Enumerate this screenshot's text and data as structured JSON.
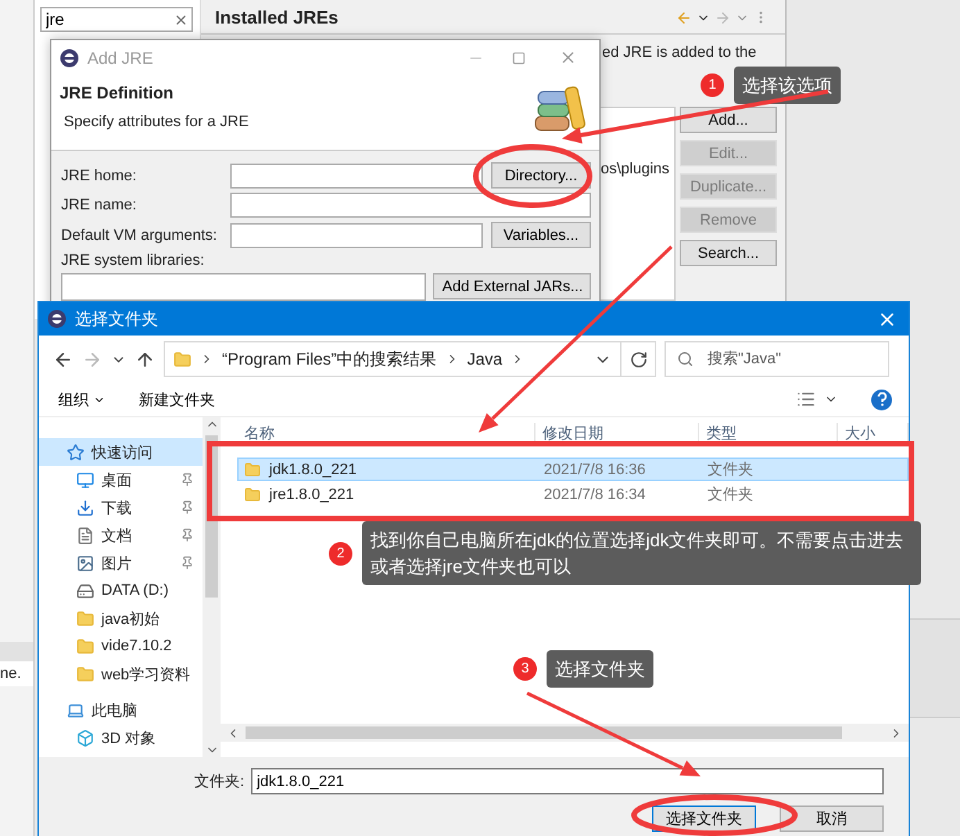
{
  "preferences": {
    "filter": {
      "value": "jre"
    },
    "title": "Installed JREs",
    "description": "ed JRE is added to the",
    "table_cell": "os\\plugins",
    "status_text": "ne.",
    "buttons": [
      {
        "label": "Add...",
        "disabled": false
      },
      {
        "label": "Edit...",
        "disabled": true
      },
      {
        "label": "Duplicate...",
        "disabled": true
      },
      {
        "label": "Remove",
        "disabled": true
      },
      {
        "label": "Search...",
        "disabled": false
      }
    ]
  },
  "add_jre_dialog": {
    "title": "Add JRE",
    "heading": "JRE Definition",
    "subtitle": "Specify attributes for a JRE",
    "fields": [
      {
        "label": "JRE home:",
        "button": "Directory..."
      },
      {
        "label": "JRE name:"
      },
      {
        "label": "Default VM arguments:",
        "button": "Variables..."
      }
    ],
    "libraries_label": "JRE system libraries:",
    "libraries_button": "Add External JARs..."
  },
  "folder_dialog": {
    "title": "选择文件夹",
    "breadcrumb": [
      "“Program Files”中的搜索结果",
      "Java"
    ],
    "search": {
      "placeholder": "搜索\"Java\""
    },
    "toolbar": [
      {
        "label": "组织",
        "dropdown": true
      },
      {
        "label": "新建文件夹",
        "dropdown": false
      }
    ],
    "sidebar": {
      "items": [
        {
          "label": "快速访问",
          "kind": "star",
          "selected": true,
          "children": [
            {
              "label": "桌面",
              "kind": "desktop",
              "selected": false,
              "pinned": true
            },
            {
              "label": "下载",
              "kind": "download",
              "selected": false,
              "pinned": true
            },
            {
              "label": "文档",
              "kind": "document",
              "selected": false,
              "pinned": true
            },
            {
              "label": "图片",
              "kind": "image",
              "selected": false,
              "pinned": true
            },
            {
              "label": "DATA (D:)",
              "kind": "drive",
              "selected": false,
              "pinned": false
            },
            {
              "label": "java初始",
              "kind": "folder",
              "selected": false,
              "pinned": false
            },
            {
              "label": "vide7.10.2",
              "kind": "folder",
              "selected": false,
              "pinned": false
            },
            {
              "label": "web学习资料",
              "kind": "folder",
              "selected": false,
              "pinned": false
            }
          ]
        },
        {
          "label": "此电脑",
          "kind": "computer",
          "selected": false,
          "children": [
            {
              "label": "3D 对象",
              "kind": "cube",
              "selected": false,
              "pinned": false
            }
          ]
        }
      ]
    },
    "columns": [
      "名称",
      "修改日期",
      "类型",
      "大小"
    ],
    "rows": [
      {
        "name": "jdk1.8.0_221",
        "modified": "2021/7/8 16:36",
        "type": "文件夹",
        "selected": true
      },
      {
        "name": "jre1.8.0_221",
        "modified": "2021/7/8 16:34",
        "type": "文件夹",
        "selected": false
      }
    ],
    "folder_field": {
      "label": "文件夹:",
      "value": "jdk1.8.0_221"
    },
    "buttons": [
      {
        "label": "选择文件夹",
        "default": true
      },
      {
        "label": "取消",
        "default": false
      }
    ]
  },
  "annotations": [
    {
      "number": "1",
      "text": "选择该选项"
    },
    {
      "number": "2",
      "text": "找到你自己电脑所在jdk的位置选择jdk文件夹即可。不需要点击进去或者选择jre文件夹也可以"
    },
    {
      "number": "3",
      "text": "选择文件夹"
    }
  ]
}
